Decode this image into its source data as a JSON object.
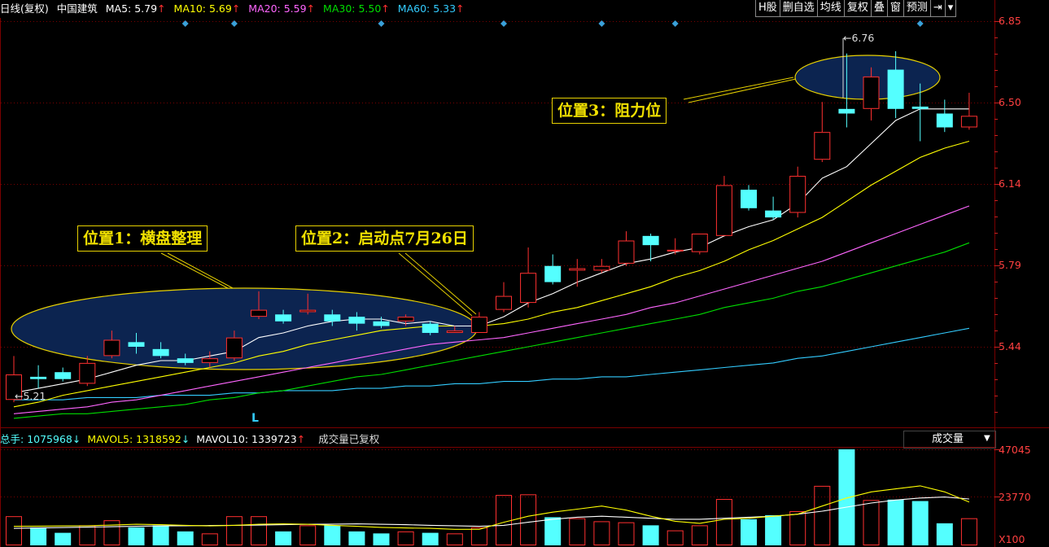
{
  "header": {
    "period": "日线(复权)",
    "stock": "中国建筑",
    "ma5": {
      "label": "MA5: ",
      "value": "5.79",
      "arrow": "↑",
      "color": "#ffffff"
    },
    "ma10": {
      "label": "MA10: ",
      "value": "5.69",
      "arrow": "↑",
      "color": "#ffff00"
    },
    "ma20": {
      "label": "MA20: ",
      "value": "5.59",
      "arrow": "↑",
      "color": "#ff66ff"
    },
    "ma30": {
      "label": "MA30: ",
      "value": "5.50",
      "arrow": "↑",
      "color": "#00dd00"
    },
    "ma60": {
      "label": "MA60: ",
      "value": "5.33",
      "arrow": "↑",
      "color": "#33ccff"
    }
  },
  "toolbar": [
    "H股",
    "删自选",
    "均线",
    "复权",
    "叠",
    "窗",
    "预测",
    "⇥",
    "▾"
  ],
  "price_axis": [
    "6.85",
    "6.50",
    "6.14",
    "5.79",
    "5.44"
  ],
  "volume_axis": [
    "47045",
    "23770",
    "X100"
  ],
  "annotations": {
    "pos1": "位置1：横盘整理",
    "pos2": "位置2：启动点7月26日",
    "pos3": "位置3：阻力位",
    "high_label": "6.76",
    "low_label": "5.21",
    "l_marker": "L"
  },
  "volume_header": {
    "total": {
      "label": "总手: ",
      "value": "1075968",
      "arrow": "↓"
    },
    "mavol5": {
      "label": "MAVOL5: ",
      "value": "1318592",
      "arrow": "↓"
    },
    "mavol10": {
      "label": "MAVOL10: ",
      "value": "1339723",
      "arrow": "↑"
    },
    "note": "成交量已复权",
    "selector": "成交量"
  },
  "colors": {
    "up": "#ff3030",
    "down": "#54ffff",
    "ma5": "#ffffff",
    "ma10": "#ffff00",
    "ma20": "#ff66ff",
    "ma30": "#00dd00",
    "ma60": "#33ccff",
    "grid": "#7a0000"
  },
  "chart_data": {
    "type": "candlestick",
    "price_range": [
      5.1,
      6.9
    ],
    "candles": [
      {
        "o": 5.21,
        "c": 5.32,
        "h": 5.4,
        "l": 5.2
      },
      {
        "o": 5.31,
        "c": 5.3,
        "h": 5.36,
        "l": 5.26
      },
      {
        "o": 5.33,
        "c": 5.3,
        "h": 5.35,
        "l": 5.29
      },
      {
        "o": 5.28,
        "c": 5.37,
        "h": 5.4,
        "l": 5.27
      },
      {
        "o": 5.4,
        "c": 5.47,
        "h": 5.51,
        "l": 5.39
      },
      {
        "o": 5.46,
        "c": 5.44,
        "h": 5.5,
        "l": 5.41
      },
      {
        "o": 5.43,
        "c": 5.4,
        "h": 5.46,
        "l": 5.39
      },
      {
        "o": 5.39,
        "c": 5.37,
        "h": 5.41,
        "l": 5.36
      },
      {
        "o": 5.37,
        "c": 5.39,
        "h": 5.42,
        "l": 5.35
      },
      {
        "o": 5.39,
        "c": 5.48,
        "h": 5.51,
        "l": 5.38
      },
      {
        "o": 5.57,
        "c": 5.6,
        "h": 5.68,
        "l": 5.56
      },
      {
        "o": 5.58,
        "c": 5.55,
        "h": 5.6,
        "l": 5.54
      },
      {
        "o": 5.59,
        "c": 5.6,
        "h": 5.67,
        "l": 5.58
      },
      {
        "o": 5.58,
        "c": 5.55,
        "h": 5.6,
        "l": 5.53
      },
      {
        "o": 5.57,
        "c": 5.54,
        "h": 5.59,
        "l": 5.51
      },
      {
        "o": 5.55,
        "c": 5.53,
        "h": 5.57,
        "l": 5.52
      },
      {
        "o": 5.55,
        "c": 5.57,
        "h": 5.58,
        "l": 5.53
      },
      {
        "o": 5.54,
        "c": 5.5,
        "h": 5.55,
        "l": 5.49
      },
      {
        "o": 5.5,
        "c": 5.51,
        "h": 5.53,
        "l": 5.5
      },
      {
        "o": 5.5,
        "c": 5.57,
        "h": 5.59,
        "l": 5.5
      },
      {
        "o": 5.6,
        "c": 5.66,
        "h": 5.72,
        "l": 5.59
      },
      {
        "o": 5.63,
        "c": 5.76,
        "h": 5.87,
        "l": 5.61
      },
      {
        "o": 5.79,
        "c": 5.72,
        "h": 5.84,
        "l": 5.71
      },
      {
        "o": 5.77,
        "c": 5.78,
        "h": 5.82,
        "l": 5.7
      },
      {
        "o": 5.77,
        "c": 5.79,
        "h": 5.82,
        "l": 5.76
      },
      {
        "o": 5.8,
        "c": 5.9,
        "h": 5.94,
        "l": 5.79
      },
      {
        "o": 5.92,
        "c": 5.88,
        "h": 5.93,
        "l": 5.81
      },
      {
        "o": 5.86,
        "c": 5.86,
        "h": 5.91,
        "l": 5.84
      },
      {
        "o": 5.85,
        "c": 5.93,
        "h": 5.93,
        "l": 5.84
      },
      {
        "o": 5.92,
        "c": 6.14,
        "h": 6.18,
        "l": 5.92
      },
      {
        "o": 6.12,
        "c": 6.04,
        "h": 6.14,
        "l": 6.03
      },
      {
        "o": 6.03,
        "c": 6.0,
        "h": 6.09,
        "l": 5.99
      },
      {
        "o": 6.02,
        "c": 6.18,
        "h": 6.22,
        "l": 6.0
      },
      {
        "o": 6.25,
        "c": 6.37,
        "h": 6.5,
        "l": 6.24
      },
      {
        "o": 6.47,
        "c": 6.45,
        "h": 6.71,
        "l": 6.39
      },
      {
        "o": 6.47,
        "c": 6.61,
        "h": 6.65,
        "l": 6.42
      },
      {
        "o": 6.64,
        "c": 6.47,
        "h": 6.72,
        "l": 6.43
      },
      {
        "o": 6.48,
        "c": 6.47,
        "h": 6.58,
        "l": 6.33
      },
      {
        "o": 6.45,
        "c": 6.39,
        "h": 6.51,
        "l": 6.37
      },
      {
        "o": 6.39,
        "c": 6.44,
        "h": 6.54,
        "l": 6.38
      }
    ],
    "ma5": [
      5.24,
      5.26,
      5.28,
      5.3,
      5.33,
      5.36,
      5.38,
      5.38,
      5.4,
      5.42,
      5.48,
      5.5,
      5.53,
      5.55,
      5.56,
      5.56,
      5.54,
      5.55,
      5.53,
      5.53,
      5.57,
      5.63,
      5.67,
      5.72,
      5.76,
      5.8,
      5.82,
      5.85,
      5.87,
      5.92,
      5.96,
      5.99,
      6.06,
      6.17,
      6.22,
      6.32,
      6.42,
      6.47,
      6.47,
      6.47
    ],
    "ma10": [
      5.18,
      5.2,
      5.23,
      5.25,
      5.27,
      5.29,
      5.31,
      5.33,
      5.35,
      5.37,
      5.4,
      5.42,
      5.45,
      5.47,
      5.49,
      5.51,
      5.52,
      5.53,
      5.53,
      5.53,
      5.54,
      5.56,
      5.59,
      5.61,
      5.64,
      5.67,
      5.7,
      5.74,
      5.77,
      5.81,
      5.86,
      5.9,
      5.95,
      6.0,
      6.07,
      6.14,
      6.2,
      6.26,
      6.3,
      6.33
    ],
    "ma20": [
      5.15,
      5.16,
      5.17,
      5.18,
      5.2,
      5.21,
      5.23,
      5.25,
      5.27,
      5.29,
      5.31,
      5.33,
      5.35,
      5.37,
      5.39,
      5.41,
      5.43,
      5.45,
      5.46,
      5.47,
      5.48,
      5.5,
      5.52,
      5.54,
      5.56,
      5.58,
      5.61,
      5.63,
      5.66,
      5.69,
      5.72,
      5.75,
      5.78,
      5.81,
      5.85,
      5.89,
      5.93,
      5.97,
      6.01,
      6.05
    ],
    "ma30": [
      5.13,
      5.14,
      5.15,
      5.15,
      5.16,
      5.17,
      5.18,
      5.19,
      5.21,
      5.22,
      5.24,
      5.25,
      5.27,
      5.29,
      5.31,
      5.32,
      5.34,
      5.36,
      5.38,
      5.4,
      5.42,
      5.44,
      5.46,
      5.48,
      5.5,
      5.52,
      5.54,
      5.56,
      5.58,
      5.61,
      5.63,
      5.65,
      5.68,
      5.7,
      5.73,
      5.76,
      5.79,
      5.82,
      5.85,
      5.89
    ],
    "ma60": [
      5.21,
      5.21,
      5.21,
      5.22,
      5.22,
      5.22,
      5.23,
      5.23,
      5.23,
      5.24,
      5.24,
      5.25,
      5.25,
      5.25,
      5.26,
      5.26,
      5.27,
      5.27,
      5.28,
      5.28,
      5.29,
      5.29,
      5.3,
      5.3,
      5.31,
      5.31,
      5.32,
      5.33,
      5.34,
      5.35,
      5.36,
      5.37,
      5.39,
      5.4,
      5.42,
      5.44,
      5.46,
      5.48,
      5.5,
      5.52
    ],
    "volume_range": [
      0,
      47045
    ],
    "volumes": [
      14000,
      8500,
      5800,
      9500,
      12000,
      8500,
      9500,
      6500,
      5500,
      14000,
      14000,
      6500,
      9500,
      9500,
      6500,
      5500,
      6500,
      5800,
      5500,
      8500,
      24500,
      24800,
      13500,
      13000,
      11500,
      11000,
      9500,
      7000,
      9500,
      22500,
      12500,
      14500,
      16500,
      29000,
      47045,
      22000,
      22200,
      21500,
      10500,
      13000
    ],
    "mavol5": [
      9000,
      9100,
      9200,
      9300,
      9600,
      10000,
      9800,
      9500,
      9200,
      9500,
      10000,
      10200,
      10000,
      9500,
      9000,
      8500,
      8200,
      8000,
      7500,
      7500,
      11000,
      14000,
      16000,
      17500,
      19000,
      17000,
      14000,
      11500,
      10500,
      12500,
      13000,
      14000,
      15000,
      19000,
      23000,
      26000,
      27500,
      29000,
      26000,
      21000
    ],
    "mavol10": [
      8000,
      8200,
      8400,
      8600,
      8800,
      9000,
      9200,
      9300,
      9400,
      9500,
      9600,
      9800,
      10000,
      10100,
      10200,
      10000,
      9800,
      9500,
      9300,
      9000,
      9500,
      11000,
      12500,
      13500,
      14000,
      13500,
      13000,
      12500,
      12500,
      13000,
      13500,
      14000,
      15000,
      16500,
      18500,
      20500,
      22000,
      23000,
      23500,
      22500
    ]
  }
}
